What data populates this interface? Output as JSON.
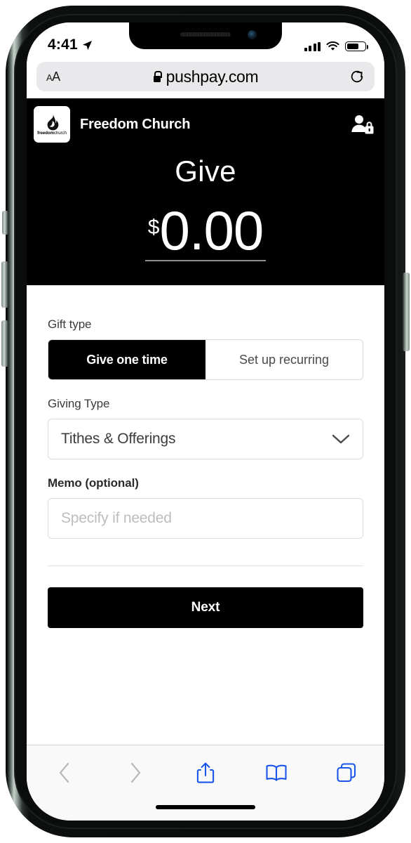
{
  "status_bar": {
    "time": "4:41",
    "location_icon": "location-arrow-icon",
    "signal_icon": "cellular-signal-icon",
    "wifi_icon": "wifi-icon",
    "battery_icon": "battery-icon",
    "battery_level_percent": 65
  },
  "browser": {
    "text_size_button": "AA",
    "lock_icon": "lock-icon",
    "url": "pushpay.com",
    "reload_icon": "reload-icon",
    "toolbar": {
      "back_icon": "chevron-left-icon",
      "forward_icon": "chevron-right-icon",
      "share_icon": "share-icon",
      "bookmarks_icon": "book-icon",
      "tabs_icon": "tabs-icon",
      "accent_color": "#1a56e8",
      "disabled_color": "#b8b8bd"
    }
  },
  "app_header": {
    "logo_word_bold": "freedom",
    "logo_word_light": "church",
    "logo_icon": "flame-icon",
    "org_name": "Freedom Church",
    "account_icon": "user-lock-icon"
  },
  "hero": {
    "title": "Give",
    "currency_symbol": "$",
    "amount": "0.00",
    "background_color": "#000000"
  },
  "form": {
    "gift_type": {
      "label": "Gift type",
      "options": [
        "Give one time",
        "Set up recurring"
      ],
      "selected": "Give one time"
    },
    "giving_type": {
      "label": "Giving Type",
      "value": "Tithes & Offerings",
      "chevron_icon": "chevron-down-icon"
    },
    "memo": {
      "label": "Memo (optional)",
      "value": "",
      "placeholder": "Specify if needed"
    }
  },
  "footer": {
    "next_label": "Next"
  }
}
